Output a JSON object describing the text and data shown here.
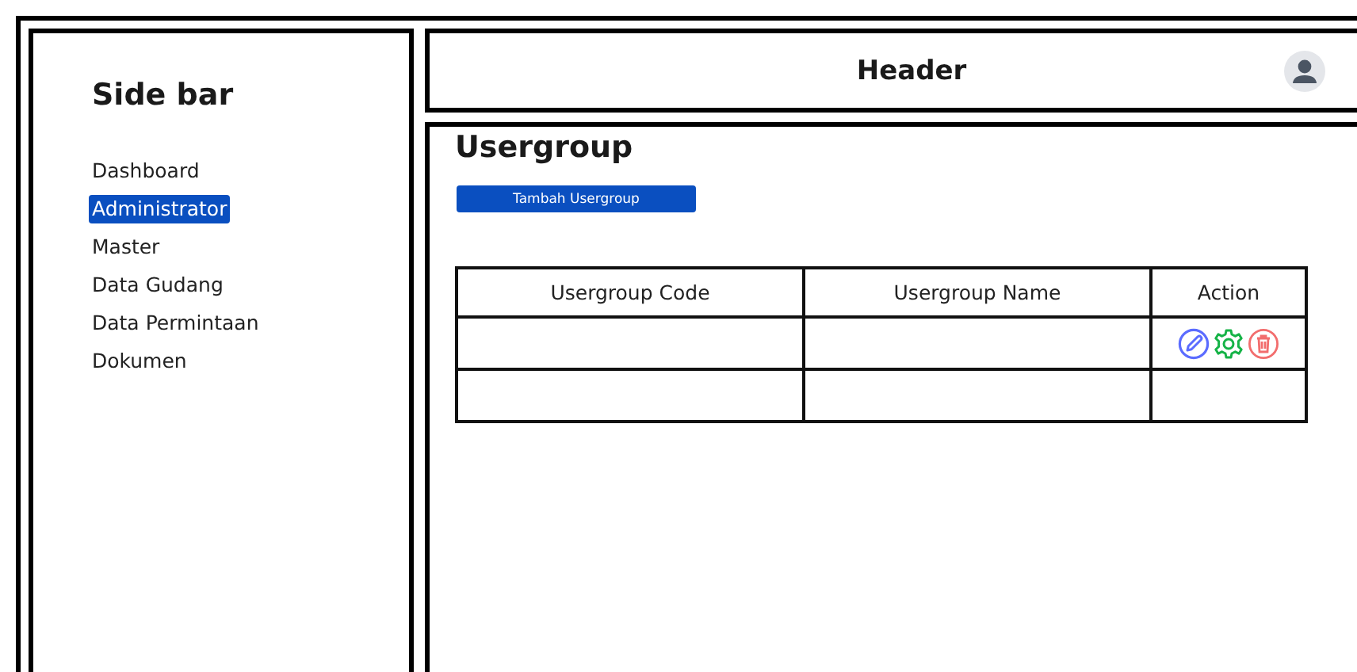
{
  "sidebar": {
    "title": "Side bar",
    "items": [
      {
        "label": "Dashboard",
        "selected": false
      },
      {
        "label": "Administrator",
        "selected": true
      },
      {
        "label": "Master",
        "selected": false
      },
      {
        "label": "Data Gudang",
        "selected": false
      },
      {
        "label": "Data Permintaan",
        "selected": false
      },
      {
        "label": "Dokumen",
        "selected": false
      }
    ]
  },
  "header": {
    "title": "Header"
  },
  "main": {
    "title": "Usergroup",
    "add_button": "Tambah Usergroup",
    "table": {
      "columns": [
        "Usergroup Code",
        "Usergroup Name",
        "Action"
      ],
      "rows": [
        {
          "actions": [
            {
              "kind": "edit",
              "color": "#5b6cff"
            },
            {
              "kind": "settings",
              "color": "#16b347"
            },
            {
              "kind": "delete",
              "color": "#f26d6d"
            }
          ]
        },
        {
          "actions": []
        }
      ]
    }
  }
}
